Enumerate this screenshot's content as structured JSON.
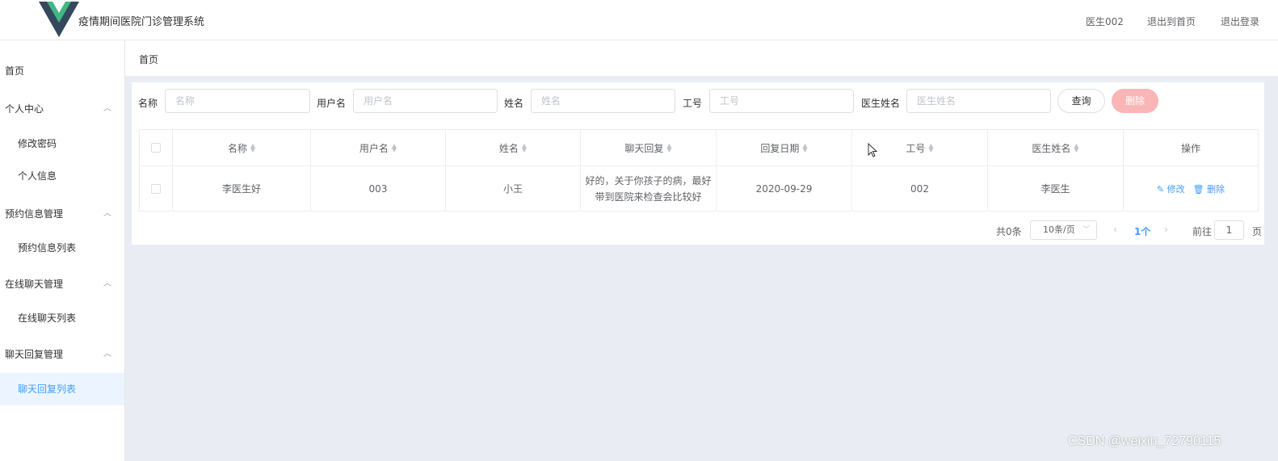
{
  "header": {
    "title": "疫情期间医院门诊管理系统",
    "user": "医生002",
    "exit_home": "退出到首页",
    "logout": "退出登录"
  },
  "sidebar": {
    "items": [
      {
        "label": "首页"
      },
      {
        "label": "个人中心"
      },
      {
        "label": "修改密码"
      },
      {
        "label": "个人信息"
      },
      {
        "label": "预约信息管理"
      },
      {
        "label": "预约信息列表"
      },
      {
        "label": "在线聊天管理"
      },
      {
        "label": "在线聊天列表"
      },
      {
        "label": "聊天回复管理"
      },
      {
        "label": "聊天回复列表"
      }
    ]
  },
  "breadcrumb": "首页",
  "search": {
    "name_label": "名称",
    "name_placeholder": "名称",
    "username_label": "用户名",
    "username_placeholder": "用户名",
    "realname_label": "姓名",
    "realname_placeholder": "姓名",
    "jobno_label": "工号",
    "jobno_placeholder": "工号",
    "doctor_label": "医生姓名",
    "doctor_placeholder": "医生姓名",
    "query_button": "查询",
    "delete_button": "删除"
  },
  "table": {
    "columns": [
      "名称",
      "用户名",
      "姓名",
      "聊天回复",
      "回复日期",
      "工号",
      "医生姓名",
      "操作"
    ],
    "rows": [
      {
        "name": "李医生好",
        "username": "003",
        "realname": "小王",
        "reply": "好的，关于你孩子的病，最好带到医院来检查会比较好",
        "date": "2020-09-29",
        "jobno": "002",
        "doctor": "李医生",
        "edit": "修改",
        "delete": "删除"
      }
    ]
  },
  "pagination": {
    "total": "共0条",
    "page_size": "10条/页",
    "current": "1个",
    "goto_label": "前往",
    "goto_value": "1",
    "page_suffix": "页"
  },
  "watermark": "CSDN @weixin_72790115",
  "colors": {
    "primary": "#409eff",
    "danger_light": "#fab6b6",
    "logo_dark": "#35495e",
    "logo_green": "#41b883",
    "background": "#e9edf3"
  }
}
